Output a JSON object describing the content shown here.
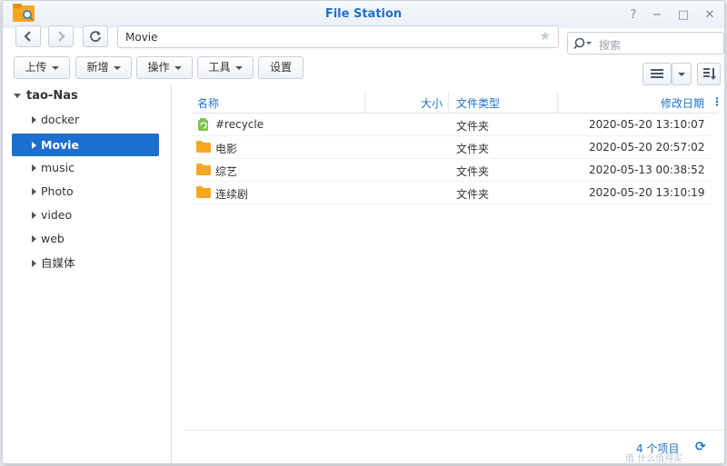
{
  "window": {
    "title": "File Station"
  },
  "titlebar_controls": [
    "?",
    "−",
    "□",
    "✕"
  ],
  "nav": {
    "back_icon": "chevron-left-icon",
    "forward_icon": "chevron-right-icon",
    "refresh_icon": "refresh-icon"
  },
  "path": {
    "value": "Movie",
    "favorite_icon": "★"
  },
  "search": {
    "placeholder": "搜索"
  },
  "toolbar": {
    "upload": "上传",
    "create": "新增",
    "action": "操作",
    "tools": "工具",
    "settings": "设置"
  },
  "sidebar": {
    "root": "tao-Nas",
    "items": [
      "docker",
      "Movie",
      "music",
      "Photo",
      "video",
      "web",
      "自媒体"
    ],
    "selected": "Movie"
  },
  "columns": {
    "name": "名称",
    "size": "大小",
    "type": "文件类型",
    "modified": "修改日期"
  },
  "files": [
    {
      "name": "#recycle",
      "type": "文件夹",
      "modified": "2020-05-20 13:10:07",
      "icon": "recycle-bin-icon"
    },
    {
      "name": "电影",
      "type": "文件夹",
      "modified": "2020-05-20 20:57:02",
      "icon": "folder-icon"
    },
    {
      "name": "综艺",
      "type": "文件夹",
      "modified": "2020-05-13 00:38:52",
      "icon": "folder-icon"
    },
    {
      "name": "连续剧",
      "type": "文件夹",
      "modified": "2020-05-20 13:10:19",
      "icon": "folder-icon"
    }
  ],
  "status": {
    "count": "4 个项目"
  },
  "watermark": "值 什么值得买",
  "colors": {
    "accent": "#1a6fcf",
    "folder": "#f5a623",
    "recycle": "#7cc44a"
  }
}
